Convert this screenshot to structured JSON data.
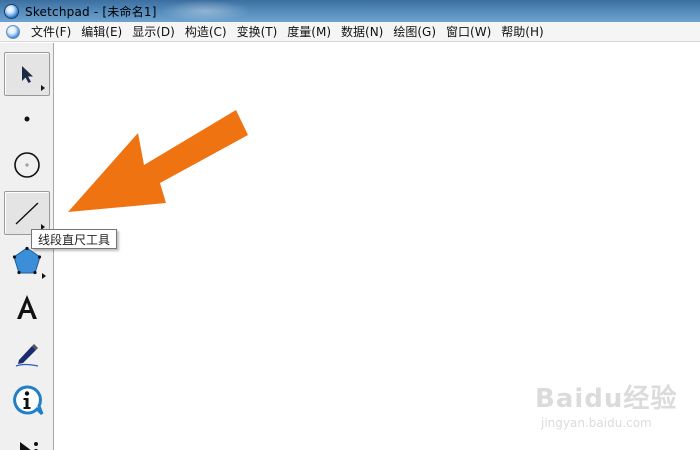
{
  "window": {
    "title": "Sketchpad  - [未命名1]"
  },
  "menu": [
    "文件(F)",
    "编辑(E)",
    "显示(D)",
    "构造(C)",
    "变换(T)",
    "度量(M)",
    "数据(N)",
    "绘图(G)",
    "窗口(W)",
    "帮助(H)"
  ],
  "tools": [
    {
      "id": "arrow-select-tool",
      "icon": "arrow-pointer-icon",
      "has_more": true
    },
    {
      "id": "point-tool",
      "icon": "point-icon",
      "has_more": false
    },
    {
      "id": "compass-tool",
      "icon": "circle-icon",
      "has_more": false
    },
    {
      "id": "straightedge-tool",
      "icon": "line-segment-icon",
      "has_more": true
    },
    {
      "id": "polygon-tool",
      "icon": "pentagon-icon",
      "has_more": true
    },
    {
      "id": "text-tool",
      "icon": "text-a-icon",
      "has_more": false
    },
    {
      "id": "marker-tool",
      "icon": "marker-pen-icon",
      "has_more": false
    },
    {
      "id": "information-tool",
      "icon": "info-icon",
      "has_more": false
    },
    {
      "id": "custom-tool",
      "icon": "custom-tool-icon",
      "has_more": false
    }
  ],
  "tooltip": {
    "text": "线段直尺工具"
  },
  "annotation": {
    "arrow_color": "#f07312"
  },
  "watermark": {
    "main": "Baidu经验",
    "sub": "jingyan.baidu.com"
  },
  "colors": {
    "titlebar": "#4f86b7",
    "toolbox_bg": "#f0f0f0",
    "polygon_fill": "#3a8fd8"
  }
}
